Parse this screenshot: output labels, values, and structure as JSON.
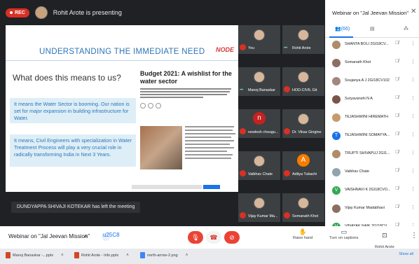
{
  "top": {
    "rec_label": "REC",
    "presenting": "Rohit Arote is presenting"
  },
  "slide": {
    "title": "UNDERSTANDING THE IMMEDIATE NEED",
    "logo": "NODE",
    "question": "What does this means to us?",
    "box1": "It means the Water Sector is booming. Our nation is set for major expansion in building infrastructure for Water.",
    "box2": "It means, Civil Engineers with specialization in Water Treatment Process will play a very crucial role in radically transforming India in Next 3 Years.",
    "article_title": "Budget 2021: A wishlist for the water sector"
  },
  "tiles": [
    {
      "name": "You",
      "kind": "photo",
      "muted": true
    },
    {
      "name": "Rohit Arote",
      "kind": "photo",
      "muted": false
    },
    {
      "name": "Manoj Banaskar",
      "kind": "photo",
      "muted": false
    },
    {
      "name": "HOD-CIVIL Git",
      "kind": "photo",
      "muted": true
    },
    {
      "name": "newlesh chougu...",
      "kind": "letter",
      "letter": "n",
      "color": "#c5221f",
      "muted": true
    },
    {
      "name": "Dr. Vikas Gingine",
      "kind": "photo",
      "muted": true
    },
    {
      "name": "Vaibhav Chate",
      "kind": "photo",
      "muted": true
    },
    {
      "name": "Aditya Tubachi",
      "kind": "letter",
      "letter": "A",
      "color": "#f57c00",
      "muted": true
    },
    {
      "name": "Vijay Kumar Ma...",
      "kind": "photo",
      "muted": true
    },
    {
      "name": "Somanath Khot",
      "kind": "photo",
      "muted": true
    }
  ],
  "left_message": "DUNDYAPPA SHIVAJI KOTEKAR has left the meeting",
  "bottom": {
    "meeting_title": "Webinar on \"Jal Jeevan Mission\"",
    "raise_hand": "Raise hand",
    "captions": "Turn on captions",
    "presenting": "Rohit Arote\nis presenting"
  },
  "taskbar": {
    "items": [
      "Manoj Banaskar -...pptx",
      "Rohit Arote - Info.pptx",
      "north-arrow-2.png"
    ],
    "show_all": "Show all"
  },
  "panel": {
    "title": "Webinar on \"Jal Jeevan Mission\"",
    "people_count": "(66)",
    "participants": [
      {
        "name": "SHANTA BOLI 2GI18CV...",
        "letter": "",
        "color": "#b08c6a"
      },
      {
        "name": "Somanath Khot",
        "letter": "",
        "color": "#8d6e63"
      },
      {
        "name": "Soujanya A J 2GI18CV102",
        "letter": "",
        "color": "#a1887f"
      },
      {
        "name": "Suryavanshi N A",
        "letter": "",
        "color": "#795548"
      },
      {
        "name": "TEJASHWINI HIREMATH",
        "letter": "",
        "color": "#c69c6d"
      },
      {
        "name": "TEJASHWINI SOMAYYA...",
        "letter": "T",
        "color": "#1a73e8"
      },
      {
        "name": "TRUPTI SHIVAPUJ 2GI1...",
        "letter": "",
        "color": "#b08c6a"
      },
      {
        "name": "Vaibhav Chate",
        "letter": "",
        "color": "#90a4ae"
      },
      {
        "name": "VAISHNAVI K 2GI18CVO...",
        "letter": "V",
        "color": "#33a852"
      },
      {
        "name": "Vijay Kumar Madabhavi",
        "letter": "",
        "color": "#8d6e63"
      },
      {
        "name": "VINAYAK NAIK 2GI18CV...",
        "letter": "V",
        "color": "#33a852"
      }
    ]
  }
}
